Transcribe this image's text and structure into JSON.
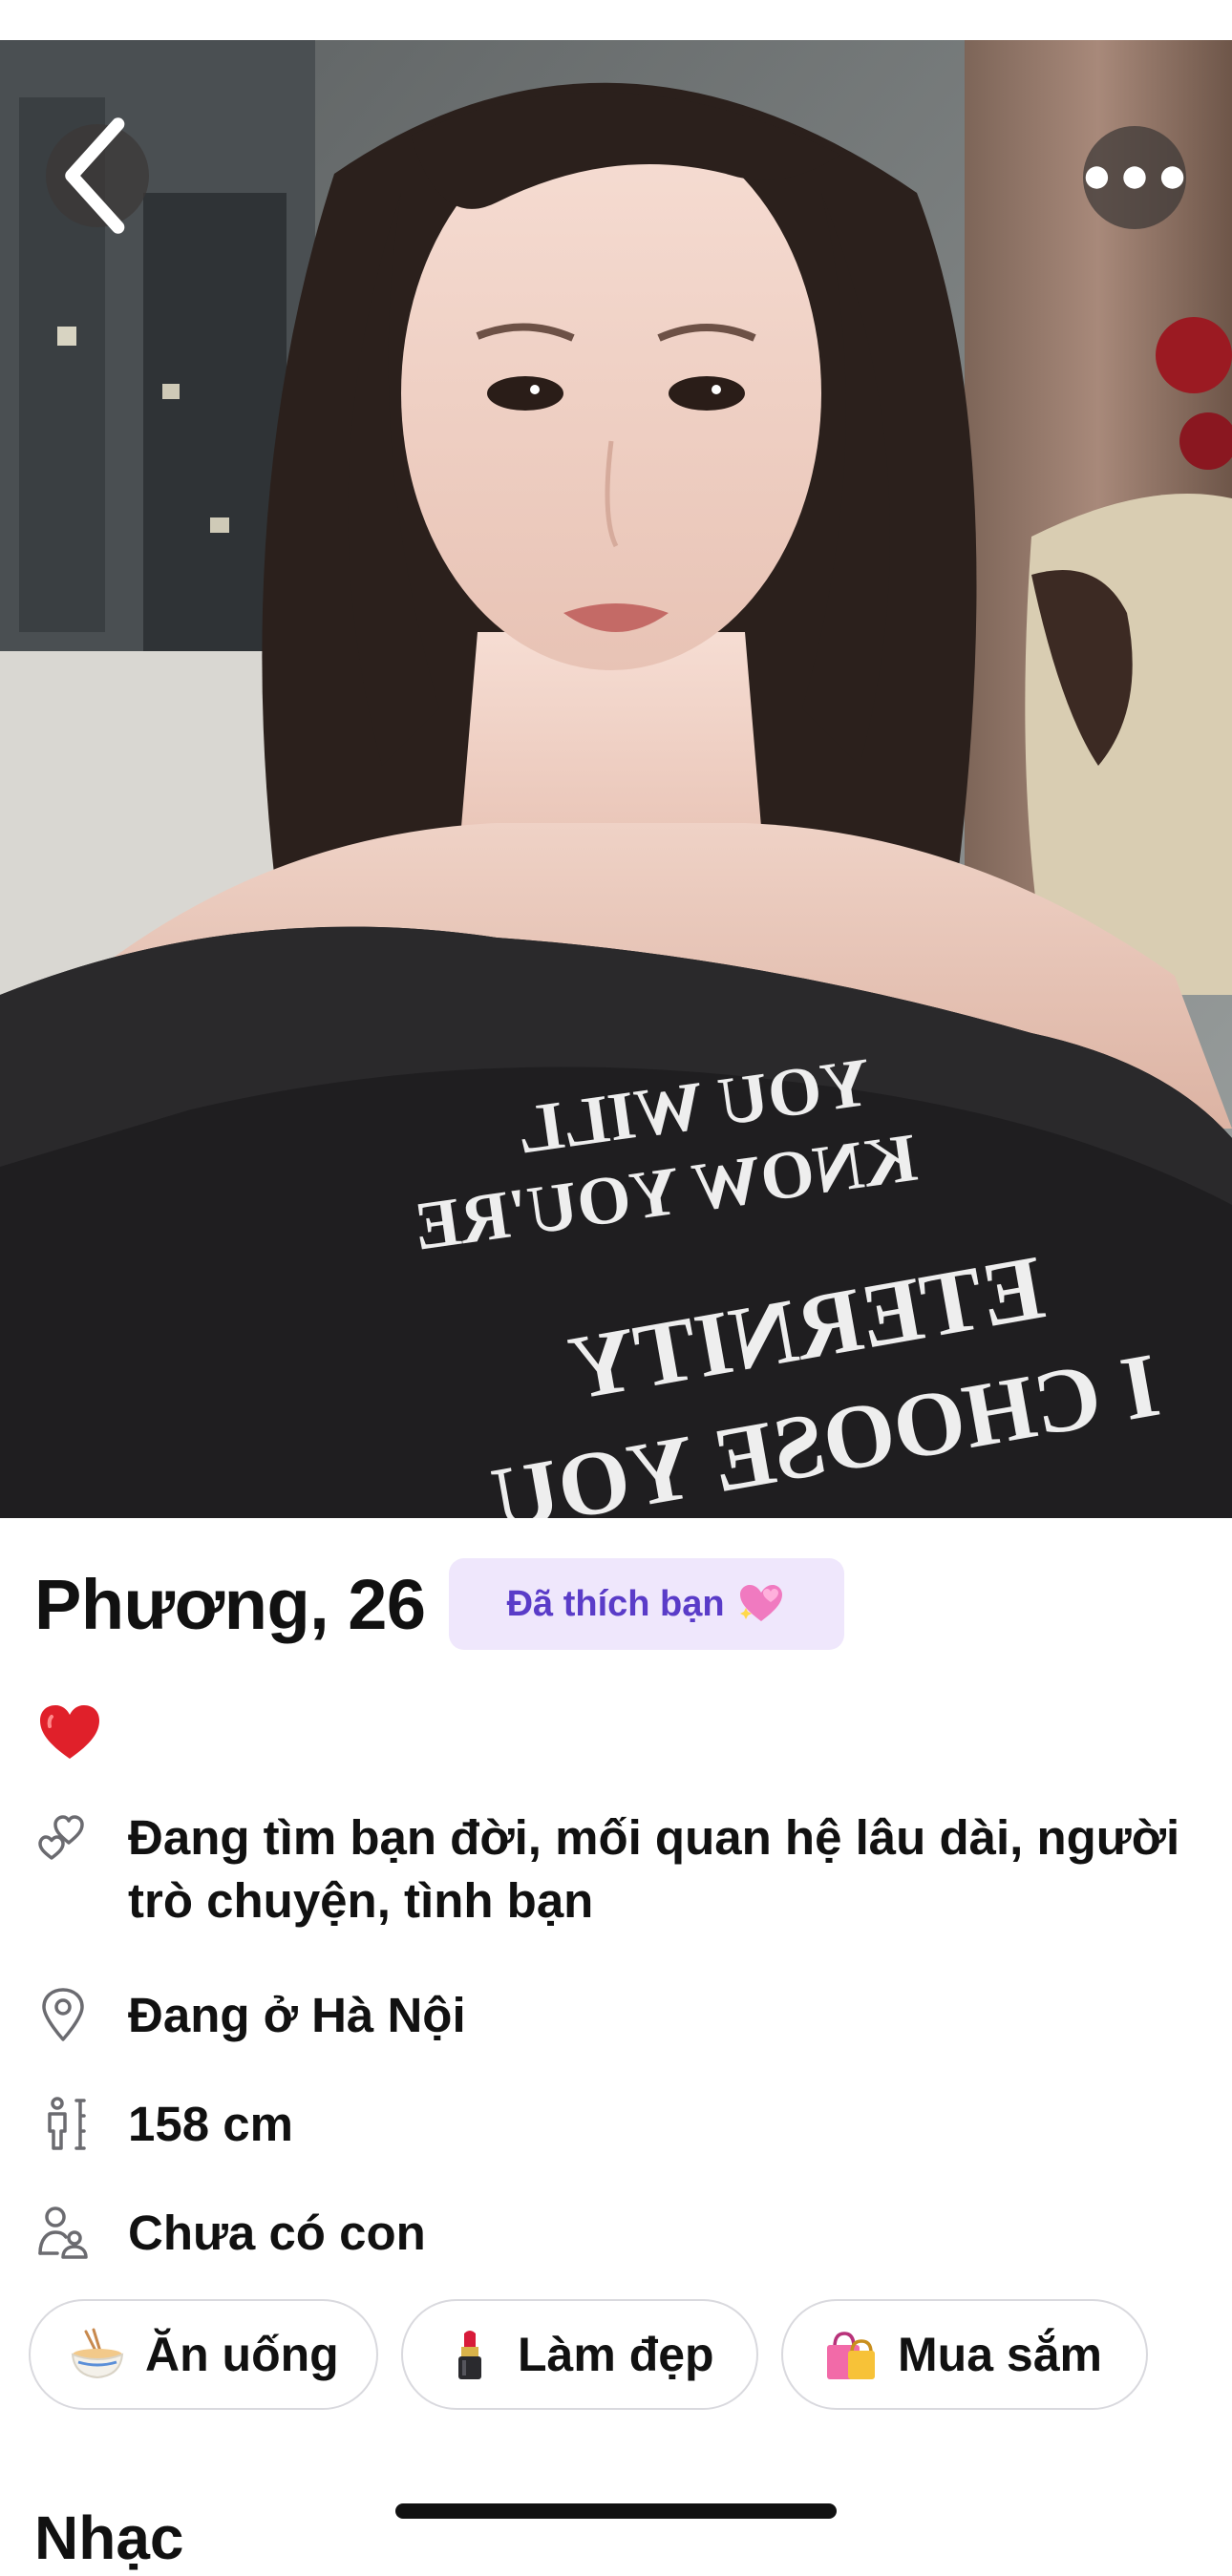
{
  "profile": {
    "name_age": "Phương, 26",
    "liked_badge": "Đã thích bạn",
    "looking_for": "Đang tìm bạn đời, mối quan hệ lâu dài, người trò chuyện, tình bạn",
    "location": "Đang ở Hà Nội",
    "height": "158 cm",
    "children": "Chưa có con"
  },
  "photo": {
    "shirt_text": {
      "line1": "YOU WILL",
      "line2": "KNOW YOU'RE",
      "line3": "ETERNITY",
      "line4": "I CHOOSE YOU"
    }
  },
  "interests": [
    {
      "label": "Ăn uống",
      "icon": "noodle-bowl-icon"
    },
    {
      "label": "Làm đẹp",
      "icon": "lipstick-icon"
    },
    {
      "label": "Mua sắm",
      "icon": "shopping-bags-icon"
    }
  ],
  "sections": {
    "next_heading": "Nhạc"
  },
  "colors": {
    "badge_bg": "#efe7fc",
    "badge_text": "#5a3cc8",
    "heart": "#e0202a",
    "text": "#111111",
    "icon_gray": "#6b6b70"
  }
}
